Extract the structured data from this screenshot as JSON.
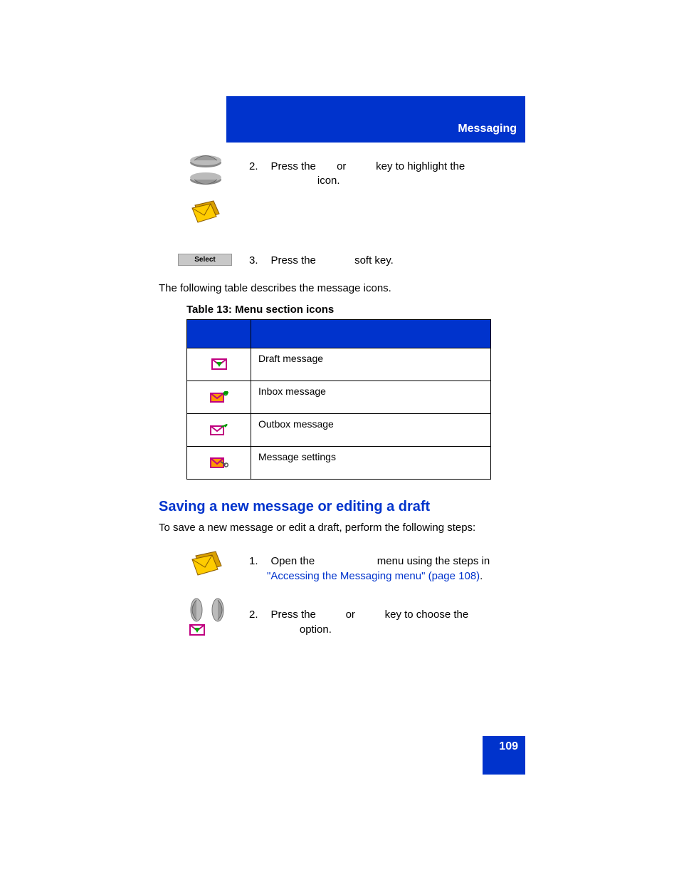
{
  "header": {
    "title": "Messaging"
  },
  "steps_upper": {
    "step2": {
      "number": "2.",
      "text_a": "Press the",
      "text_b": "or",
      "text_c": "key to highlight the",
      "text_d": "icon."
    },
    "step3": {
      "number": "3.",
      "text_a": "Press the",
      "text_b": "soft key.",
      "button_label": "Select"
    }
  },
  "intro": "The following table describes the message icons.",
  "table": {
    "caption": "Table 13: Menu section icons",
    "rows": [
      {
        "desc": "Draft message"
      },
      {
        "desc": "Inbox message"
      },
      {
        "desc": "Outbox message"
      },
      {
        "desc": "Message settings"
      }
    ]
  },
  "section": {
    "heading": "Saving a new message or editing a draft",
    "intro": "To save a new message or edit a draft, perform the following steps:"
  },
  "steps_lower": {
    "step1": {
      "number": "1.",
      "text_a": "Open the",
      "text_b": "menu using the steps in",
      "link": "\"Accessing the Messaging menu\" (page 108)",
      "tail": "."
    },
    "step2": {
      "number": "2.",
      "text_a": "Press the",
      "text_b": "or",
      "text_c": "key to choose the",
      "text_d": "option."
    }
  },
  "page_number": "109"
}
